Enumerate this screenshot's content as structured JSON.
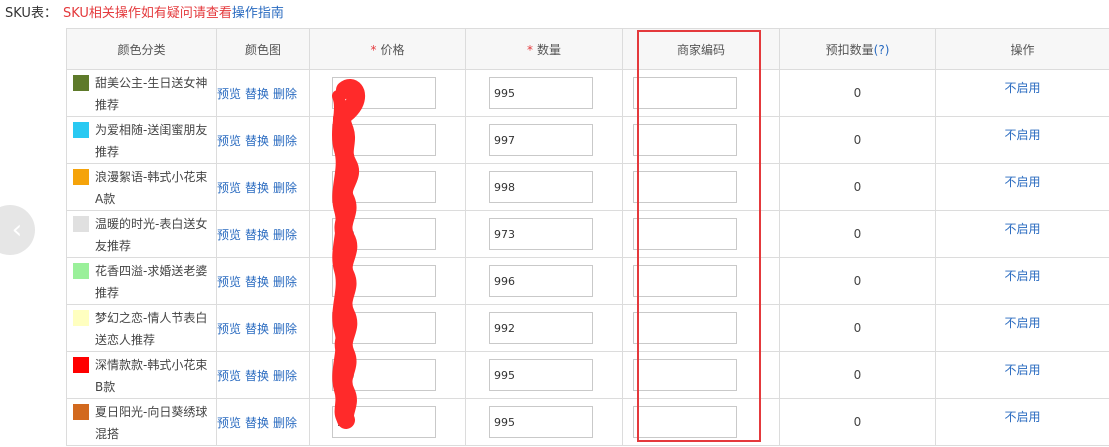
{
  "header": {
    "label": "SKU表：",
    "notice": "SKU相关操作如有疑问请查看",
    "guide_link": "操作指南"
  },
  "table": {
    "columns": {
      "color_category": "颜色分类",
      "color_image": "颜色图",
      "price": "价格",
      "quantity": "数量",
      "merchant_code": "商家编码",
      "reserved_qty": "预扣数量",
      "reserved_help": "(?)",
      "operation": "操作"
    },
    "required_mark": "*",
    "image_actions": {
      "preview": "预览",
      "replace": "替换",
      "delete": "删除"
    },
    "rows": [
      {
        "color": "#5e7a2a",
        "name": "甜美公主-生日送女神推荐",
        "price": ".00",
        "quantity": "995",
        "code": "",
        "reserved": "0",
        "op": "不启用"
      },
      {
        "color": "#29c9f2",
        "name": "为爱相随-送闺蜜朋友推荐",
        "price": ".00",
        "quantity": "997",
        "code": "",
        "reserved": "0",
        "op": "不启用"
      },
      {
        "color": "#f5a30a",
        "name": "浪漫絮语-韩式小花束A款",
        "price": ".00",
        "quantity": "998",
        "code": "",
        "reserved": "0",
        "op": "不启用"
      },
      {
        "color": "#e0e0e0",
        "name": "温暖的时光-表白送女友推荐",
        "price": ".00",
        "quantity": "973",
        "code": "",
        "reserved": "0",
        "op": "不启用"
      },
      {
        "color": "#9af09a",
        "name": "花香四溢-求婚送老婆推荐",
        "price": ".00",
        "quantity": "996",
        "code": "",
        "reserved": "0",
        "op": "不启用"
      },
      {
        "color": "#ffffc0",
        "name": "梦幻之恋-情人节表白送恋人推荐",
        "price": ".00",
        "quantity": "992",
        "code": "",
        "reserved": "0",
        "op": "不启用"
      },
      {
        "color": "#ff0000",
        "name": "深情款款-韩式小花束B款",
        "price": ".00",
        "quantity": "995",
        "code": "",
        "reserved": "0",
        "op": "不启用"
      },
      {
        "color": "#d2691e",
        "name": "夏日阳光-向日葵绣球混搭",
        "price": ".00",
        "quantity": "995",
        "code": "",
        "reserved": "0",
        "op": "不启用"
      }
    ]
  },
  "navigation": {
    "prev_icon": "chevron-left-icon",
    "prev_glyph": "‹"
  },
  "annotations": {
    "highlight_color": "#e4393c",
    "scribble_color": "#ff2a2a"
  }
}
